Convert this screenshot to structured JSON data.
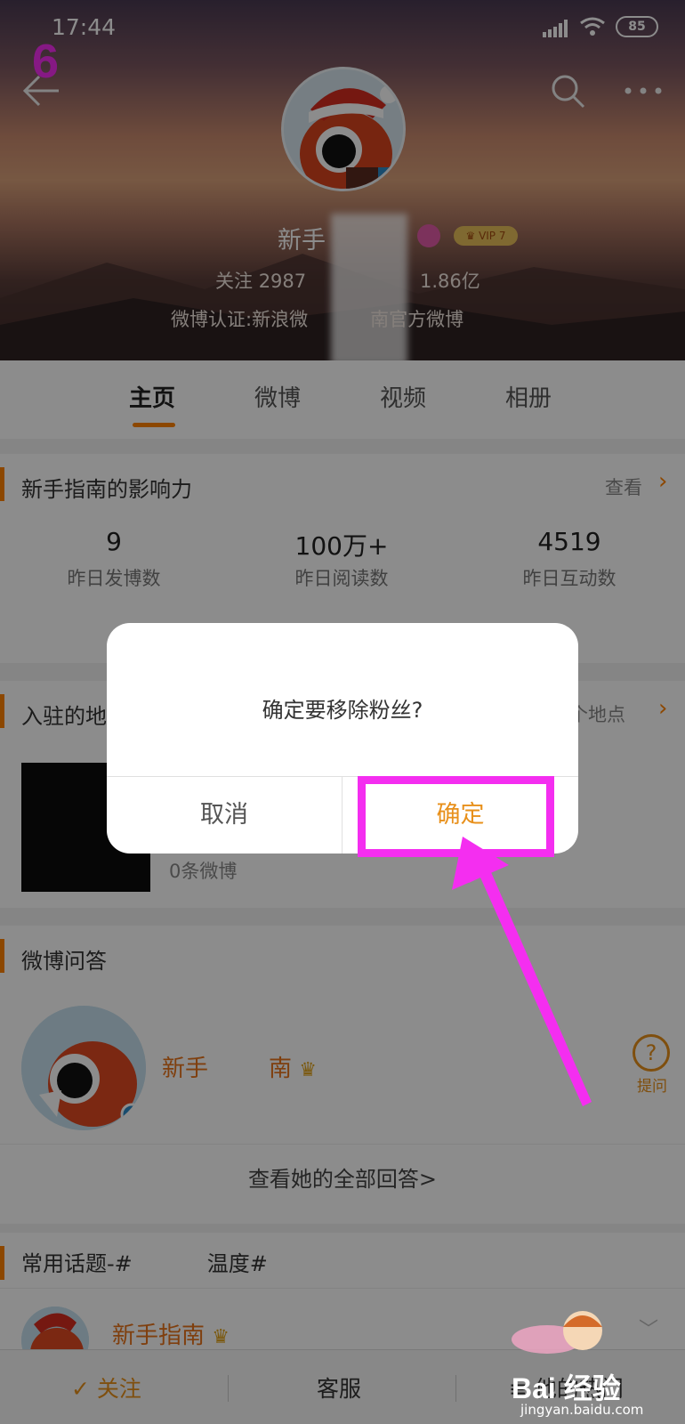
{
  "status_bar": {
    "time": "17:44",
    "battery": "85"
  },
  "step_number": "6",
  "profile": {
    "name": "新手",
    "vip": "VIP 7",
    "follow_label": "关注",
    "follow_count": "2987",
    "fans_count": "1.86亿",
    "verify_left": "微博认证:新浪微",
    "verify_right": "南官方微博"
  },
  "tabs": [
    {
      "label": "主页"
    },
    {
      "label": "微博"
    },
    {
      "label": "视频"
    },
    {
      "label": "相册"
    }
  ],
  "influence": {
    "title": "新手指南的影响力",
    "more": "查看",
    "stats": [
      {
        "value": "9",
        "label": "昨日发博数"
      },
      {
        "value": "100万+",
        "label": "昨日阅读数"
      },
      {
        "value": "4519",
        "label": "昨日互动数"
      }
    ]
  },
  "places": {
    "title": "入驻的地",
    "more": "个地点",
    "count": "0条微博"
  },
  "qa": {
    "title": "微博问答",
    "user_name": "新手",
    "user_name_tail": "南",
    "ask_label": "提问",
    "view_all": "查看她的全部回答>"
  },
  "topics": {
    "title_left": "常用话题-#",
    "title_right": "温度#",
    "user_name": "新手指南"
  },
  "bottom_bar": {
    "follow": "关注",
    "service": "客服",
    "other": "他的热门"
  },
  "dialog": {
    "message": "确定要移除粉丝?",
    "cancel": "取消",
    "confirm": "确定"
  },
  "watermark": {
    "brand": "Bai 经验",
    "url": "jingyan.baidu.com"
  },
  "colors": {
    "accent": "#ff8200",
    "highlight": "#f42ef0",
    "confirm_text": "#e8901b"
  }
}
